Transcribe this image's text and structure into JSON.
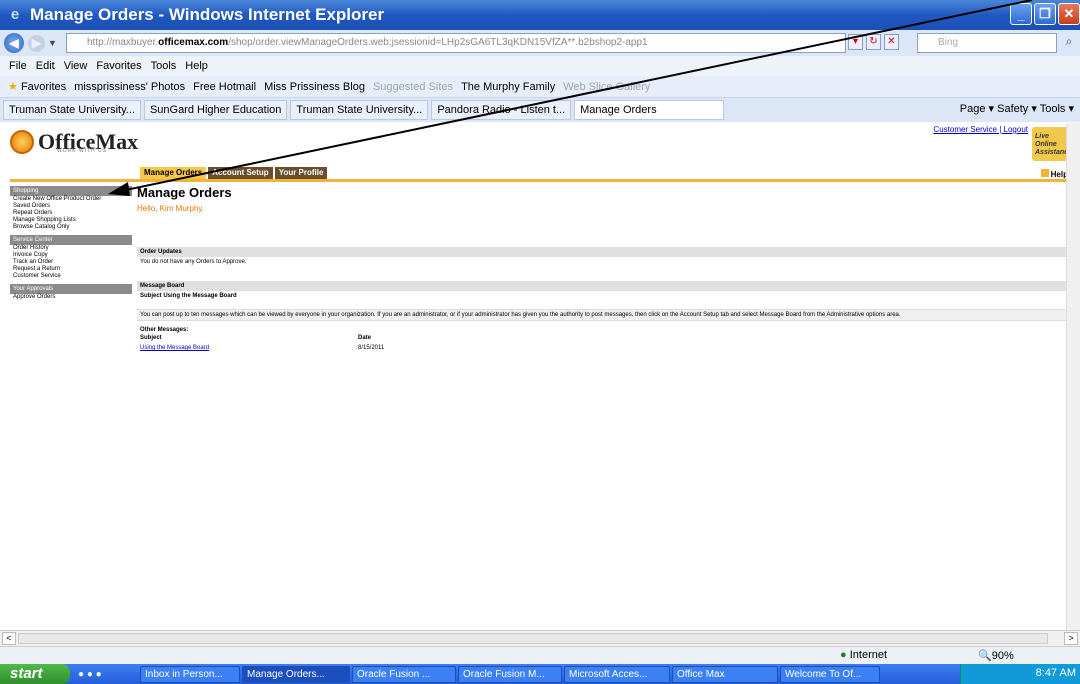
{
  "window": {
    "title": "Manage Orders - Windows Internet Explorer"
  },
  "address": {
    "url_prefix": "http://maxbuyer.",
    "url_domain": "officemax.com",
    "url_suffix": "/shop/order.viewManageOrders.web;jsessionid=LHp2sGA6TL3qKDN15VfZA**.b2bshop2-app1",
    "search_placeholder": "Bing"
  },
  "menu": [
    "File",
    "Edit",
    "View",
    "Favorites",
    "Tools",
    "Help"
  ],
  "favorites": {
    "label": "Favorites",
    "items": [
      "missprissiness' Photos",
      "Free Hotmail",
      "Miss Prissiness Blog",
      "Suggested Sites",
      "The Murphy Family",
      "Web Slice Gallery"
    ]
  },
  "tabs": [
    "Truman State University...",
    "SunGard Higher Education",
    "Truman State University...",
    "Pandora Radio - Listen t...",
    "Manage Orders"
  ],
  "command_bar": "Page ▾   Safety ▾   Tools ▾",
  "site": {
    "logo": "OfficeMax",
    "tagline": "WORK WITH US",
    "top_links": "Customer Service | Logout",
    "live_assist": "Live Online Assistance",
    "help": "Help",
    "main_tabs": [
      "Manage Orders",
      "Account Setup",
      "Your Profile"
    ]
  },
  "sidebar": {
    "sections": [
      {
        "title": "Shopping",
        "items": [
          "Create New Office Product Order",
          "Saved Orders",
          "Repeat Orders",
          "Manage Shopping Lists",
          "Browse Catalog Only"
        ]
      },
      {
        "title": "Service Center",
        "items": [
          "Order History",
          "Invoice Copy",
          "Track an Order",
          "Request a Return",
          "Customer Service"
        ]
      },
      {
        "title": "Your Approvals",
        "items": [
          "Approve Orders"
        ]
      }
    ]
  },
  "content": {
    "heading": "Manage Orders",
    "greeting": "Hello, Kim Murphy.",
    "order_updates_title": "Order Updates",
    "order_updates_text": "You do not have any Orders to Approve.",
    "message_board_title": "Message Board",
    "message_subject": "Subject Using the Message Board",
    "message_body": "You can post up to ten messages which can be viewed by everyone in your organization. If you are an administrator, or if your administrator has given you the authority to post messages, then click on the Account Setup tab and select Message Board from the Administrative options area.",
    "other_messages": "Other Messages:",
    "col_subject": "Subject",
    "col_date": "Date",
    "row_link": "Using the Message Board",
    "row_date": "8/15/2011"
  },
  "status": {
    "zone": "Internet",
    "zoom": "90%"
  },
  "taskbar": {
    "start": "start",
    "tasks": [
      "Inbox in Person...",
      "Manage Orders...",
      "Oracle Fusion ...",
      "Oracle Fusion M...",
      "Microsoft Acces...",
      "Office Max",
      "Welcome To Of..."
    ],
    "clock": "8:47 AM"
  }
}
